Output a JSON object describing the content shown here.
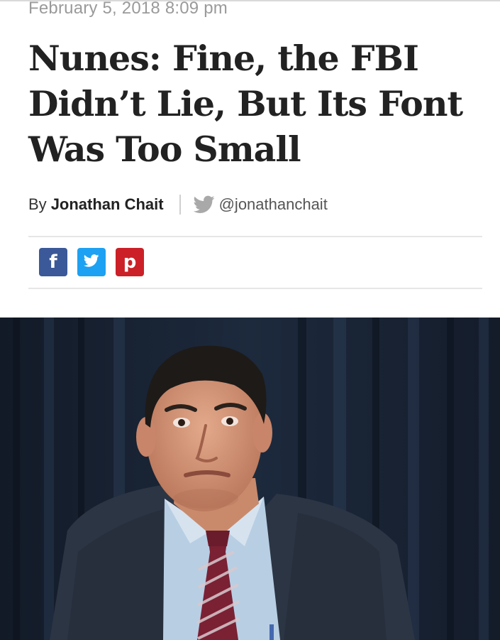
{
  "article": {
    "dateline": "February 5, 2018 8:09 pm",
    "headline": "Nunes: Fine, the FBI Didn’t Lie, But Its Font Was Too Small",
    "byline": {
      "prefix": "By",
      "author": "Jonathan Chait",
      "twitter_handle": "@jonathanchait",
      "twitter_icon": "twitter-bird-icon"
    },
    "share_buttons": [
      {
        "network": "facebook",
        "glyph": "f",
        "icon": "facebook-icon",
        "color": "#3b5998"
      },
      {
        "network": "twitter",
        "glyph": "",
        "icon": "twitter-bird-icon",
        "color": "#1da1f2"
      },
      {
        "network": "pinterest",
        "glyph": "p",
        "icon": "pinterest-icon",
        "color": "#cb2027"
      }
    ]
  },
  "colors": {
    "headline": "#222222",
    "dateline": "#9a9a9a",
    "twitter_brand": "#1da1f2",
    "photo_curtain": "#1b2535"
  }
}
